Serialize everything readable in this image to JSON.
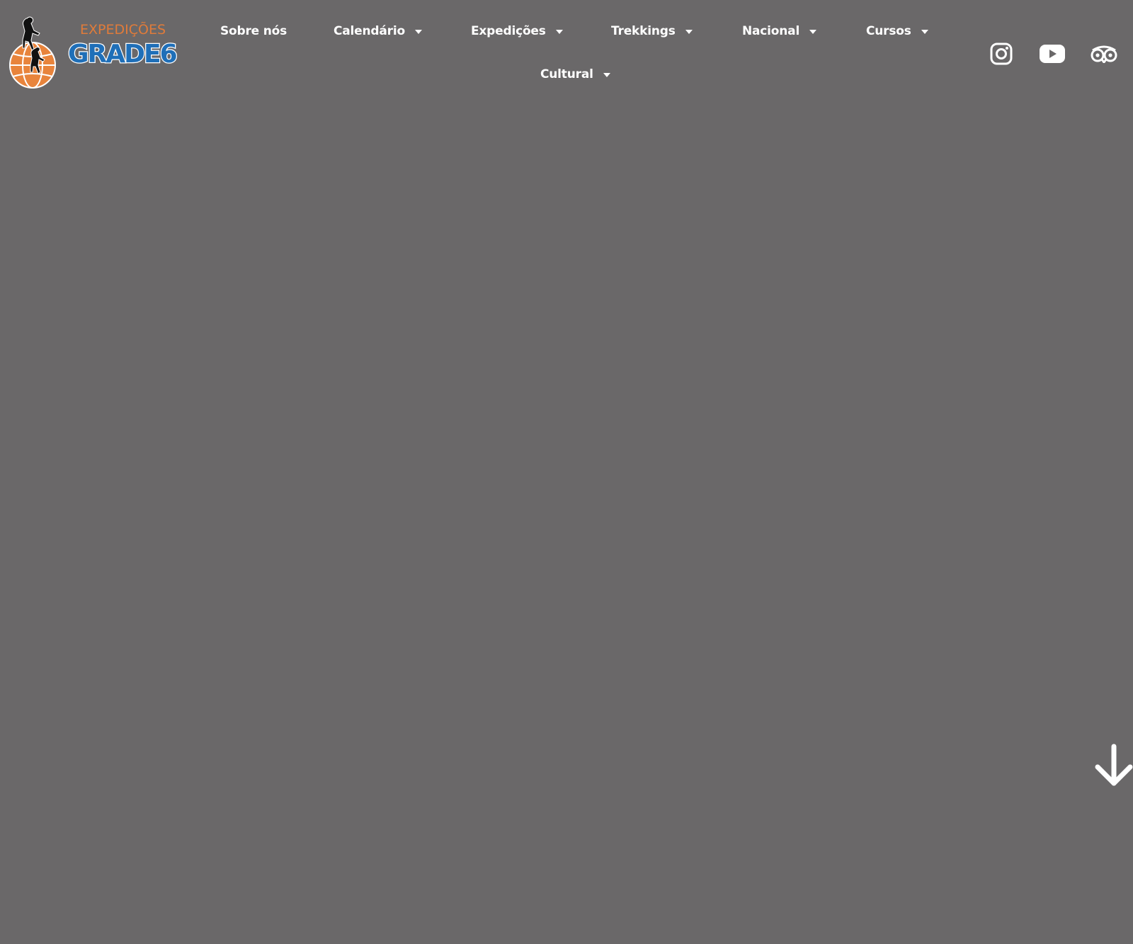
{
  "brand": {
    "line1": "EXPEDIÇÕES",
    "line2": "GRADE6",
    "colors": {
      "orange": "#e8843c",
      "blue": "#1f6fb8",
      "text_orange": "#e07b3a"
    }
  },
  "nav": {
    "items": [
      {
        "label": "Sobre nós",
        "has_dropdown": false
      },
      {
        "label": "Calendário",
        "has_dropdown": true
      },
      {
        "label": "Expedições",
        "has_dropdown": true
      },
      {
        "label": "Trekkings",
        "has_dropdown": true
      },
      {
        "label": "Nacional",
        "has_dropdown": true
      },
      {
        "label": "Cursos",
        "has_dropdown": true
      },
      {
        "label": "Cultural",
        "has_dropdown": true
      }
    ]
  },
  "social": {
    "icons": [
      "instagram-icon",
      "youtube-icon",
      "tripadvisor-icon"
    ]
  },
  "hero": {
    "background": "#6a6869",
    "scroll_icon": "arrow-down-icon"
  }
}
